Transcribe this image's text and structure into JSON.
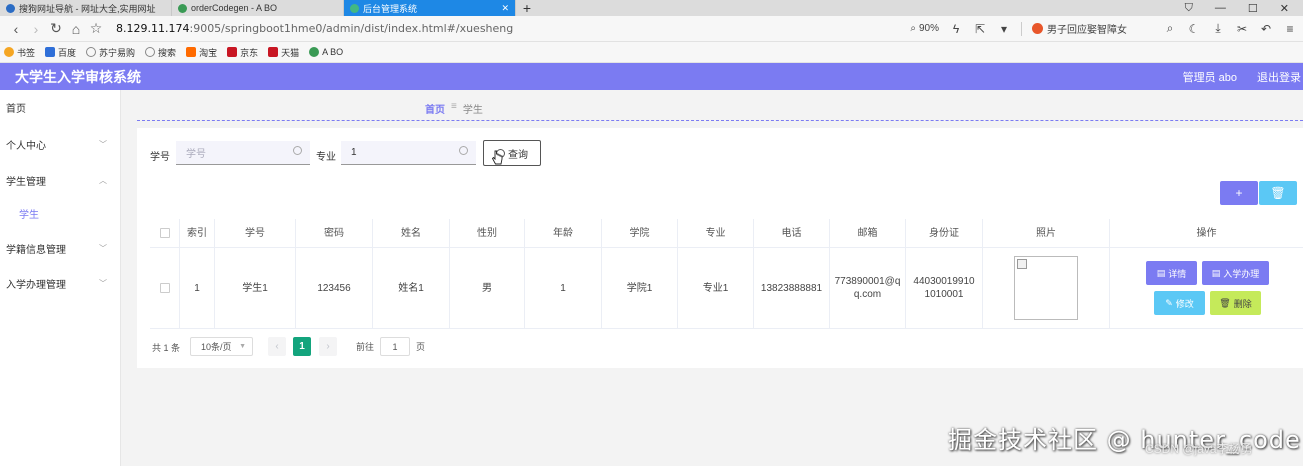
{
  "browser": {
    "tabs": [
      {
        "title": "搜狗网址导航 - 网址大全,实用网址",
        "active": false,
        "color": "#2b6cc4"
      },
      {
        "title": "orderCodegen - A BO",
        "active": false,
        "color": "#3a9a55"
      },
      {
        "title": "后台管理系统",
        "active": true,
        "color": "#3a9a55"
      }
    ],
    "new_tab": "+",
    "url_host": "8.129.11.174",
    "url_path": ":9005/springboot1hme0/admin/dist/index.html#/xuesheng",
    "zoom": "90%",
    "search_suggestion": "男子回应娶智障女",
    "bookmarks": [
      "书签",
      "百度",
      "苏宁易购",
      "搜索",
      "淘宝",
      "京东",
      "天猫",
      "A BO"
    ]
  },
  "app": {
    "title": "大学生入学审核系统",
    "user_label": "管理员 abo",
    "logout": "退出登录",
    "accent": "#7b7bf2"
  },
  "sidebar": {
    "items": [
      {
        "label": "首页",
        "chevron": false
      },
      {
        "label": "个人中心",
        "chevron": true
      },
      {
        "label": "学生管理",
        "chevron": true
      },
      {
        "label": "学生",
        "chevron": false,
        "sub": true
      },
      {
        "label": "学籍信息管理",
        "chevron": true
      },
      {
        "label": "入学办理管理",
        "chevron": true
      }
    ]
  },
  "breadcrumb": {
    "home": "首页",
    "current": "学生"
  },
  "search": {
    "student_no_label": "学号",
    "student_no_placeholder": "学号",
    "major_label": "专业",
    "major_value": "1",
    "query_button": "查询"
  },
  "table": {
    "headers": [
      "索引",
      "学号",
      "密码",
      "姓名",
      "性别",
      "年龄",
      "学院",
      "专业",
      "电话",
      "邮箱",
      "身份证",
      "照片",
      "操作"
    ],
    "rows": [
      {
        "index": "1",
        "student_no": "学生1",
        "password": "123456",
        "name": "姓名1",
        "gender": "男",
        "age": "1",
        "college": "学院1",
        "major": "专业1",
        "phone": "13823888881",
        "email": "773890001@qq.com",
        "id_card": "440300199101010001"
      }
    ],
    "row_actions": {
      "detail": "详情",
      "enroll": "入学办理",
      "edit": "修改",
      "delete": "删除"
    }
  },
  "pagination": {
    "total": "共 1 条",
    "page_size": "10条/页",
    "current_page": "1",
    "goto_label": "前往",
    "goto_value": "1",
    "page_suffix": "页"
  },
  "watermark": {
    "main": "掘金技术社区 @ hunter_code",
    "sub": "CSDN @java李杨勇"
  }
}
